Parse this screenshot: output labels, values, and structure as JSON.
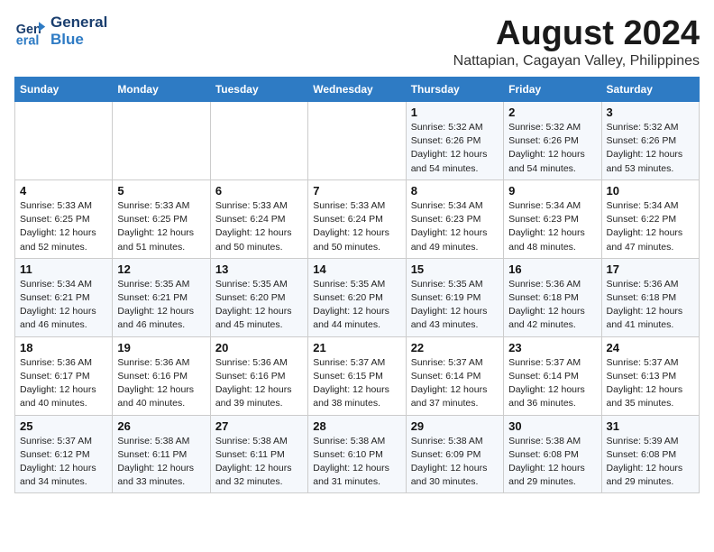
{
  "header": {
    "logo_line1": "General",
    "logo_line2": "Blue",
    "title": "August 2024",
    "subtitle": "Nattapian, Cagayan Valley, Philippines"
  },
  "weekdays": [
    "Sunday",
    "Monday",
    "Tuesday",
    "Wednesday",
    "Thursday",
    "Friday",
    "Saturday"
  ],
  "weeks": [
    [
      {
        "day": "",
        "info": ""
      },
      {
        "day": "",
        "info": ""
      },
      {
        "day": "",
        "info": ""
      },
      {
        "day": "",
        "info": ""
      },
      {
        "day": "1",
        "info": "Sunrise: 5:32 AM\nSunset: 6:26 PM\nDaylight: 12 hours\nand 54 minutes."
      },
      {
        "day": "2",
        "info": "Sunrise: 5:32 AM\nSunset: 6:26 PM\nDaylight: 12 hours\nand 54 minutes."
      },
      {
        "day": "3",
        "info": "Sunrise: 5:32 AM\nSunset: 6:26 PM\nDaylight: 12 hours\nand 53 minutes."
      }
    ],
    [
      {
        "day": "4",
        "info": "Sunrise: 5:33 AM\nSunset: 6:25 PM\nDaylight: 12 hours\nand 52 minutes."
      },
      {
        "day": "5",
        "info": "Sunrise: 5:33 AM\nSunset: 6:25 PM\nDaylight: 12 hours\nand 51 minutes."
      },
      {
        "day": "6",
        "info": "Sunrise: 5:33 AM\nSunset: 6:24 PM\nDaylight: 12 hours\nand 50 minutes."
      },
      {
        "day": "7",
        "info": "Sunrise: 5:33 AM\nSunset: 6:24 PM\nDaylight: 12 hours\nand 50 minutes."
      },
      {
        "day": "8",
        "info": "Sunrise: 5:34 AM\nSunset: 6:23 PM\nDaylight: 12 hours\nand 49 minutes."
      },
      {
        "day": "9",
        "info": "Sunrise: 5:34 AM\nSunset: 6:23 PM\nDaylight: 12 hours\nand 48 minutes."
      },
      {
        "day": "10",
        "info": "Sunrise: 5:34 AM\nSunset: 6:22 PM\nDaylight: 12 hours\nand 47 minutes."
      }
    ],
    [
      {
        "day": "11",
        "info": "Sunrise: 5:34 AM\nSunset: 6:21 PM\nDaylight: 12 hours\nand 46 minutes."
      },
      {
        "day": "12",
        "info": "Sunrise: 5:35 AM\nSunset: 6:21 PM\nDaylight: 12 hours\nand 46 minutes."
      },
      {
        "day": "13",
        "info": "Sunrise: 5:35 AM\nSunset: 6:20 PM\nDaylight: 12 hours\nand 45 minutes."
      },
      {
        "day": "14",
        "info": "Sunrise: 5:35 AM\nSunset: 6:20 PM\nDaylight: 12 hours\nand 44 minutes."
      },
      {
        "day": "15",
        "info": "Sunrise: 5:35 AM\nSunset: 6:19 PM\nDaylight: 12 hours\nand 43 minutes."
      },
      {
        "day": "16",
        "info": "Sunrise: 5:36 AM\nSunset: 6:18 PM\nDaylight: 12 hours\nand 42 minutes."
      },
      {
        "day": "17",
        "info": "Sunrise: 5:36 AM\nSunset: 6:18 PM\nDaylight: 12 hours\nand 41 minutes."
      }
    ],
    [
      {
        "day": "18",
        "info": "Sunrise: 5:36 AM\nSunset: 6:17 PM\nDaylight: 12 hours\nand 40 minutes."
      },
      {
        "day": "19",
        "info": "Sunrise: 5:36 AM\nSunset: 6:16 PM\nDaylight: 12 hours\nand 40 minutes."
      },
      {
        "day": "20",
        "info": "Sunrise: 5:36 AM\nSunset: 6:16 PM\nDaylight: 12 hours\nand 39 minutes."
      },
      {
        "day": "21",
        "info": "Sunrise: 5:37 AM\nSunset: 6:15 PM\nDaylight: 12 hours\nand 38 minutes."
      },
      {
        "day": "22",
        "info": "Sunrise: 5:37 AM\nSunset: 6:14 PM\nDaylight: 12 hours\nand 37 minutes."
      },
      {
        "day": "23",
        "info": "Sunrise: 5:37 AM\nSunset: 6:14 PM\nDaylight: 12 hours\nand 36 minutes."
      },
      {
        "day": "24",
        "info": "Sunrise: 5:37 AM\nSunset: 6:13 PM\nDaylight: 12 hours\nand 35 minutes."
      }
    ],
    [
      {
        "day": "25",
        "info": "Sunrise: 5:37 AM\nSunset: 6:12 PM\nDaylight: 12 hours\nand 34 minutes."
      },
      {
        "day": "26",
        "info": "Sunrise: 5:38 AM\nSunset: 6:11 PM\nDaylight: 12 hours\nand 33 minutes."
      },
      {
        "day": "27",
        "info": "Sunrise: 5:38 AM\nSunset: 6:11 PM\nDaylight: 12 hours\nand 32 minutes."
      },
      {
        "day": "28",
        "info": "Sunrise: 5:38 AM\nSunset: 6:10 PM\nDaylight: 12 hours\nand 31 minutes."
      },
      {
        "day": "29",
        "info": "Sunrise: 5:38 AM\nSunset: 6:09 PM\nDaylight: 12 hours\nand 30 minutes."
      },
      {
        "day": "30",
        "info": "Sunrise: 5:38 AM\nSunset: 6:08 PM\nDaylight: 12 hours\nand 29 minutes."
      },
      {
        "day": "31",
        "info": "Sunrise: 5:39 AM\nSunset: 6:08 PM\nDaylight: 12 hours\nand 29 minutes."
      }
    ]
  ]
}
